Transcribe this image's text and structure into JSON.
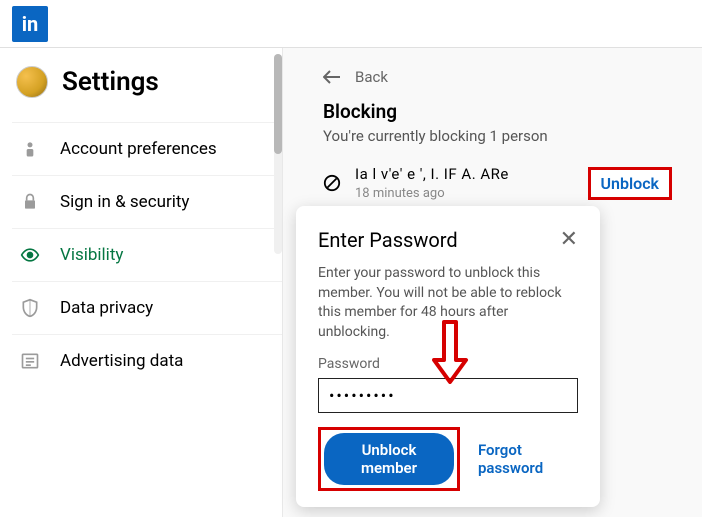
{
  "logo_text": "in",
  "sidebar": {
    "title": "Settings",
    "items": [
      {
        "label": "Account preferences"
      },
      {
        "label": "Sign in & security"
      },
      {
        "label": "Visibility"
      },
      {
        "label": "Data privacy"
      },
      {
        "label": "Advertising data"
      }
    ]
  },
  "content": {
    "back_label": "Back",
    "heading": "Blocking",
    "subheading": "You're currently blocking 1 person",
    "blocked_name": "Ia l v'e' e ', I. IF A. ARe",
    "blocked_time": "18 minutes ago",
    "unblock_label": "Unblock"
  },
  "modal": {
    "title": "Enter Password",
    "body": "Enter your password to unblock this member. You will not be able to reblock this member for 48 hours after unblocking.",
    "pw_label": "Password",
    "pw_value": "•••••••••",
    "unblock_btn": "Unblock member",
    "forgot": "Forgot password"
  }
}
